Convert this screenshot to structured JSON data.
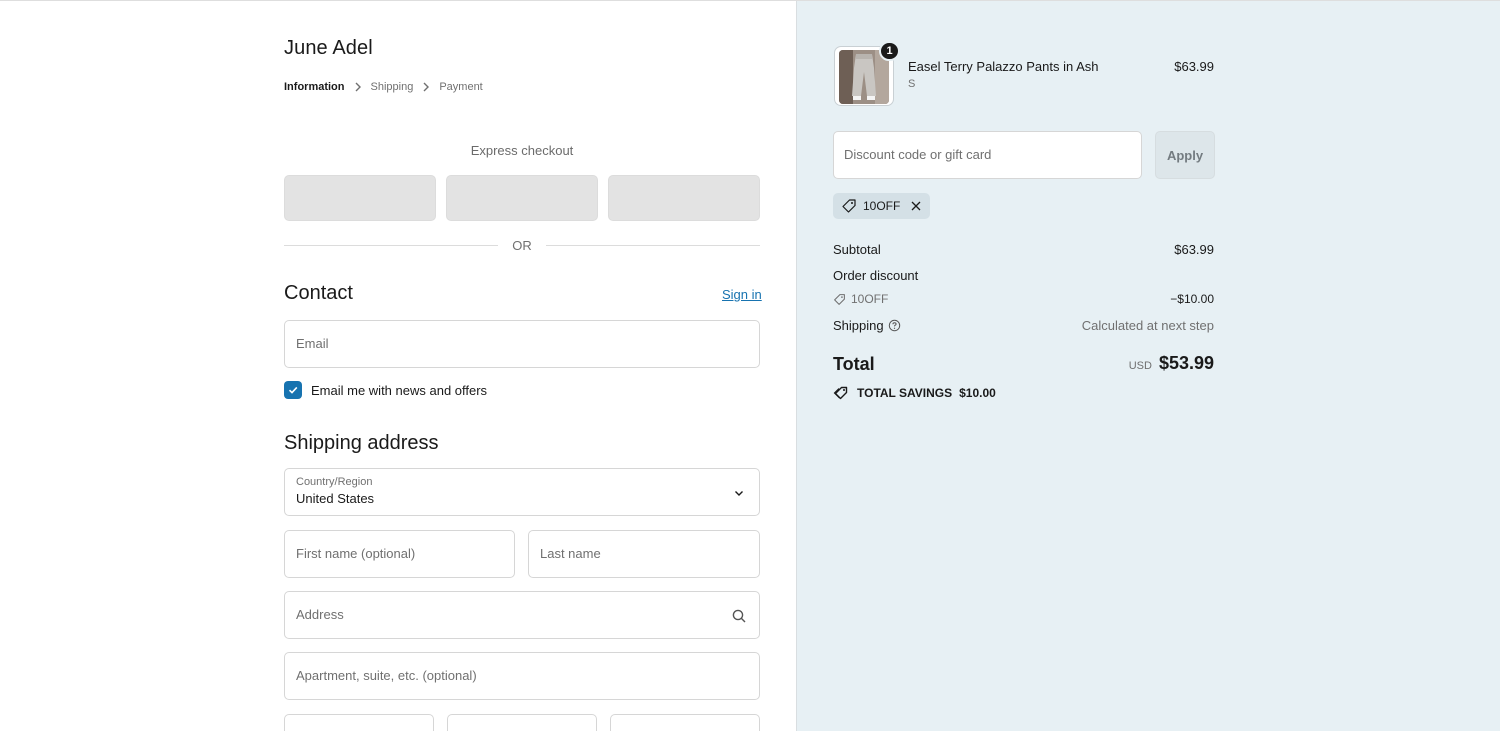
{
  "store": {
    "name": "June Adel"
  },
  "breadcrumb": [
    {
      "label": "Information",
      "current": true
    },
    {
      "label": "Shipping",
      "current": false
    },
    {
      "label": "Payment",
      "current": false
    }
  ],
  "express": {
    "label": "Express checkout",
    "or_label": "OR"
  },
  "contact": {
    "heading": "Contact",
    "sign_in": "Sign in",
    "email_placeholder": "Email",
    "newsletter_label": "Email me with news and offers",
    "newsletter_checked": true
  },
  "shipping": {
    "heading": "Shipping address",
    "country_label": "Country/Region",
    "country_value": "United States",
    "first_name_placeholder": "First name (optional)",
    "last_name_placeholder": "Last name",
    "address_placeholder": "Address",
    "apartment_placeholder": "Apartment, suite, etc. (optional)"
  },
  "summary": {
    "product": {
      "name": "Easel Terry Palazzo Pants in Ash",
      "variant": "S",
      "price": "$63.99",
      "quantity": "1"
    },
    "discount_placeholder": "Discount code or gift card",
    "apply_label": "Apply",
    "applied_code": "10OFF",
    "subtotal_label": "Subtotal",
    "subtotal_value": "$63.99",
    "order_discount_label": "Order discount",
    "order_discount_code": "10OFF",
    "order_discount_value": "−$10.00",
    "shipping_label": "Shipping",
    "shipping_value": "Calculated at next step",
    "total_label": "Total",
    "total_currency": "USD",
    "total_value": "$53.99",
    "savings_label": "TOTAL SAVINGS",
    "savings_value": "$10.00"
  },
  "colors": {
    "accent": "#1773b0",
    "summary_bg": "#e7f0f4",
    "chip_bg": "#d4e0e6",
    "express_btn": "#e3e3e3"
  }
}
